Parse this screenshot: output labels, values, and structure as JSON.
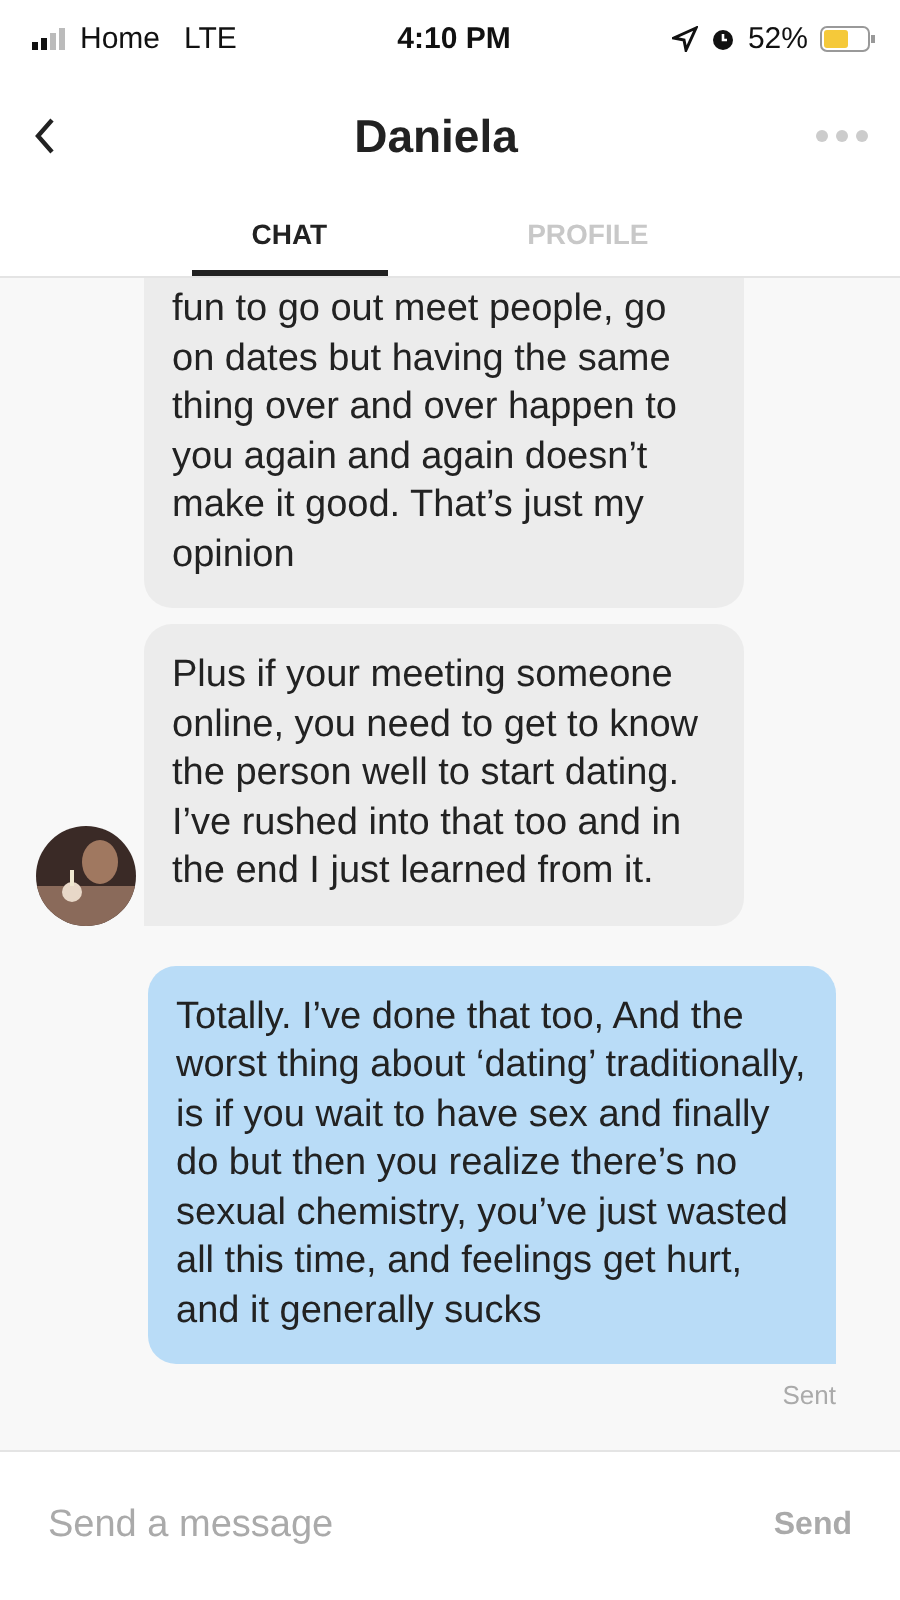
{
  "status_bar": {
    "carrier": "Home",
    "network": "LTE",
    "time": "4:10 PM",
    "battery": "52%"
  },
  "header": {
    "title": "Daniela"
  },
  "tabs": [
    {
      "label": "CHAT",
      "selected": true
    },
    {
      "label": "PROFILE",
      "selected": false
    }
  ],
  "messages": [
    {
      "kind": "received",
      "text": "fun to go out meet people, go on dates but having the same thing over and over happen to you again and again doesn’t make it good. That’s just my opinion",
      "avatar": false
    },
    {
      "kind": "received",
      "text": "Plus if your meeting someone online, you need to get to know the person well to start dating. I’ve rushed into that too and in the end I just learned from it.",
      "avatar": true
    },
    {
      "kind": "sent",
      "text": "Totally. I’ve done that too, And the worst thing about ‘dating’ traditionally, is if you wait to have sex and finally do but then you realize there’s no sexual chemistry, you’ve just wasted all this time, and feelings get hurt, and it generally sucks",
      "status": "Sent"
    }
  ],
  "composer": {
    "placeholder": "Send a message",
    "button": "Send"
  }
}
